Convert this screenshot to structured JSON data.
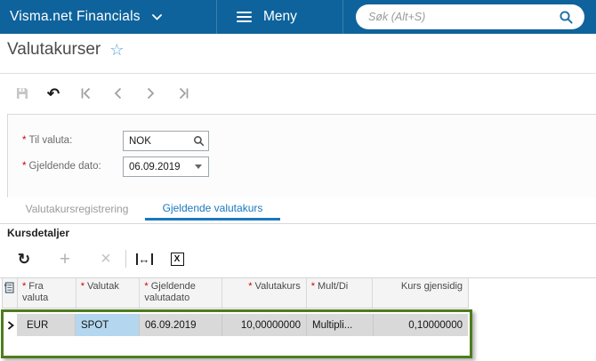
{
  "topbar": {
    "brand": "Visma.net Financials",
    "menu_label": "Meny",
    "search_placeholder": "Søk (Alt+S)"
  },
  "page": {
    "title": "Valutakurser"
  },
  "form": {
    "fields": [
      {
        "marker": "*",
        "label": "Til valuta:",
        "value": "NOK"
      },
      {
        "marker": "*",
        "label": "Gjeldende dato:",
        "value": "06.09.2019"
      }
    ]
  },
  "tabs": [
    {
      "label": "Valutakursregistrering",
      "active": false
    },
    {
      "label": "Gjeldende valutakurs",
      "active": true
    }
  ],
  "section": {
    "title": "Kursdetaljer"
  },
  "grid": {
    "columns": [
      {
        "marker": "*",
        "label": "Fra valuta"
      },
      {
        "marker": "*",
        "label": "Valutak"
      },
      {
        "marker": "*",
        "label": "Gjeldende valutadato"
      },
      {
        "marker": "*",
        "label": "Valutakurs"
      },
      {
        "marker": "*",
        "label": "Mult/Di"
      },
      {
        "marker": "",
        "label": "Kurs gjensidig"
      }
    ],
    "rows": [
      [
        "EUR",
        "SPOT",
        "06.09.2019",
        "10,00000000",
        "Multipli...",
        "0,10000000"
      ]
    ]
  },
  "icons": {
    "star": "☆",
    "undo": "↶",
    "refresh": "↻",
    "plus": "+",
    "close": "×",
    "fit_width": "↔",
    "excel": "X"
  },
  "colors": {
    "topbar_blue": "#0e639c",
    "active_tab_blue": "#1a78be",
    "highlight_green": "#4d7c1e",
    "selected_cell_blue": "#b4d7ef",
    "row_gray": "#d9d9d9",
    "required_red": "#cc0000"
  }
}
